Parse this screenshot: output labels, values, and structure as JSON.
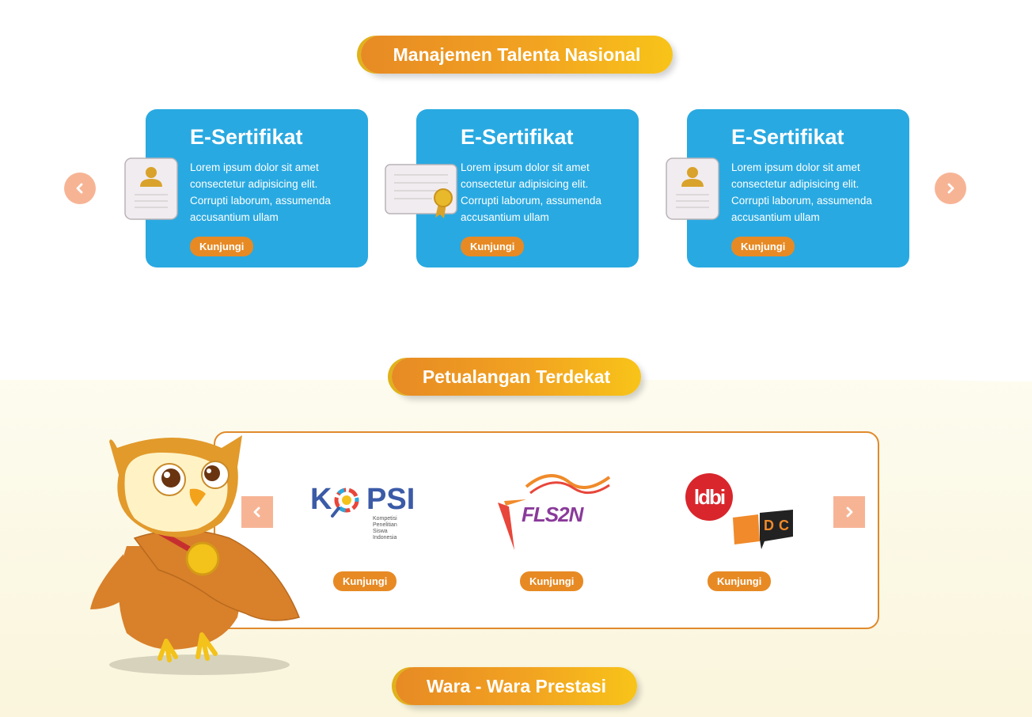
{
  "talent": {
    "title": "Manajemen Talenta Nasional",
    "cards": [
      {
        "title": "E-Sertifikat",
        "text": "Lorem ipsum dolor sit amet consectetur adipisicing elit. Corrupti laborum, assumenda accusantium ullam",
        "button": "Kunjungi",
        "icon": "id-card-icon"
      },
      {
        "title": "E-Sertifikat",
        "text": "Lorem ipsum dolor sit amet consectetur adipisicing elit. Corrupti laborum, assumenda accusantium ullam",
        "button": "Kunjungi",
        "icon": "certificate-icon"
      },
      {
        "title": "E-Sertifikat",
        "text": "Lorem ipsum dolor sit amet consectetur adipisicing elit. Corrupti laborum, assumenda accusantium ullam",
        "button": "Kunjungi",
        "icon": "id-card-icon"
      }
    ]
  },
  "adventure": {
    "title": "Petualangan Terdekat",
    "items": [
      {
        "logo_main": "K",
        "logo_rest": "PSI",
        "logo_sub": "Kompetisi Penelitian Siswa Indonesia",
        "button": "Kunjungi"
      },
      {
        "logo_main": "FLS2N",
        "button": "Kunjungi"
      },
      {
        "logo_main": "ldbi",
        "logo_sub": "NSDC",
        "button": "Kunjungi"
      }
    ]
  },
  "news": {
    "title": "Wara - Wara Prestasi"
  },
  "colors": {
    "accent": "#e78a24",
    "card_blue": "#29a9e1",
    "arrow_bg": "#f7b495",
    "cream": "#faf5dc"
  }
}
